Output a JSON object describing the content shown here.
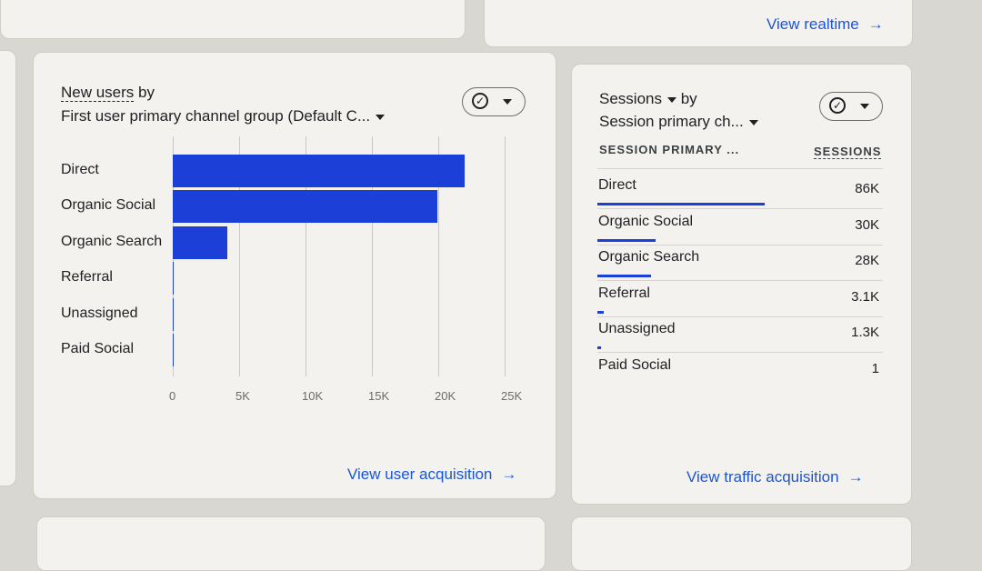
{
  "realtime_link": "View realtime",
  "new_users_card": {
    "title_metric": "New users",
    "title_by": "by",
    "dimension": "First user primary channel group (Default C...",
    "link": "View user acquisition"
  },
  "sessions_card": {
    "title_metric": "Sessions",
    "title_by": "by",
    "dimension": "Session primary ch...",
    "col_dimension": "SESSION PRIMARY ...",
    "col_metric": "SESSIONS",
    "rows": [
      {
        "label": "Direct",
        "value": "86K",
        "share": 1.0
      },
      {
        "label": "Organic Social",
        "value": "30K",
        "share": 0.35
      },
      {
        "label": "Organic Search",
        "value": "28K",
        "share": 0.32
      },
      {
        "label": "Referral",
        "value": "3.1K",
        "share": 0.036
      },
      {
        "label": "Unassigned",
        "value": "1.3K",
        "share": 0.015
      },
      {
        "label": "Paid Social",
        "value": "1",
        "share": 0.0
      }
    ],
    "link": "View traffic acquisition"
  },
  "chart_data": {
    "type": "bar",
    "orientation": "horizontal",
    "categories": [
      "Direct",
      "Organic Social",
      "Organic Search",
      "Referral",
      "Unassigned",
      "Paid Social"
    ],
    "values": [
      22000,
      19900,
      4100,
      60,
      30,
      0
    ],
    "xlim": [
      0,
      25000
    ],
    "xticks": [
      "0",
      "5K",
      "10K",
      "15K",
      "20K",
      "25K"
    ],
    "grid": true,
    "color": "#1c3fd8"
  }
}
